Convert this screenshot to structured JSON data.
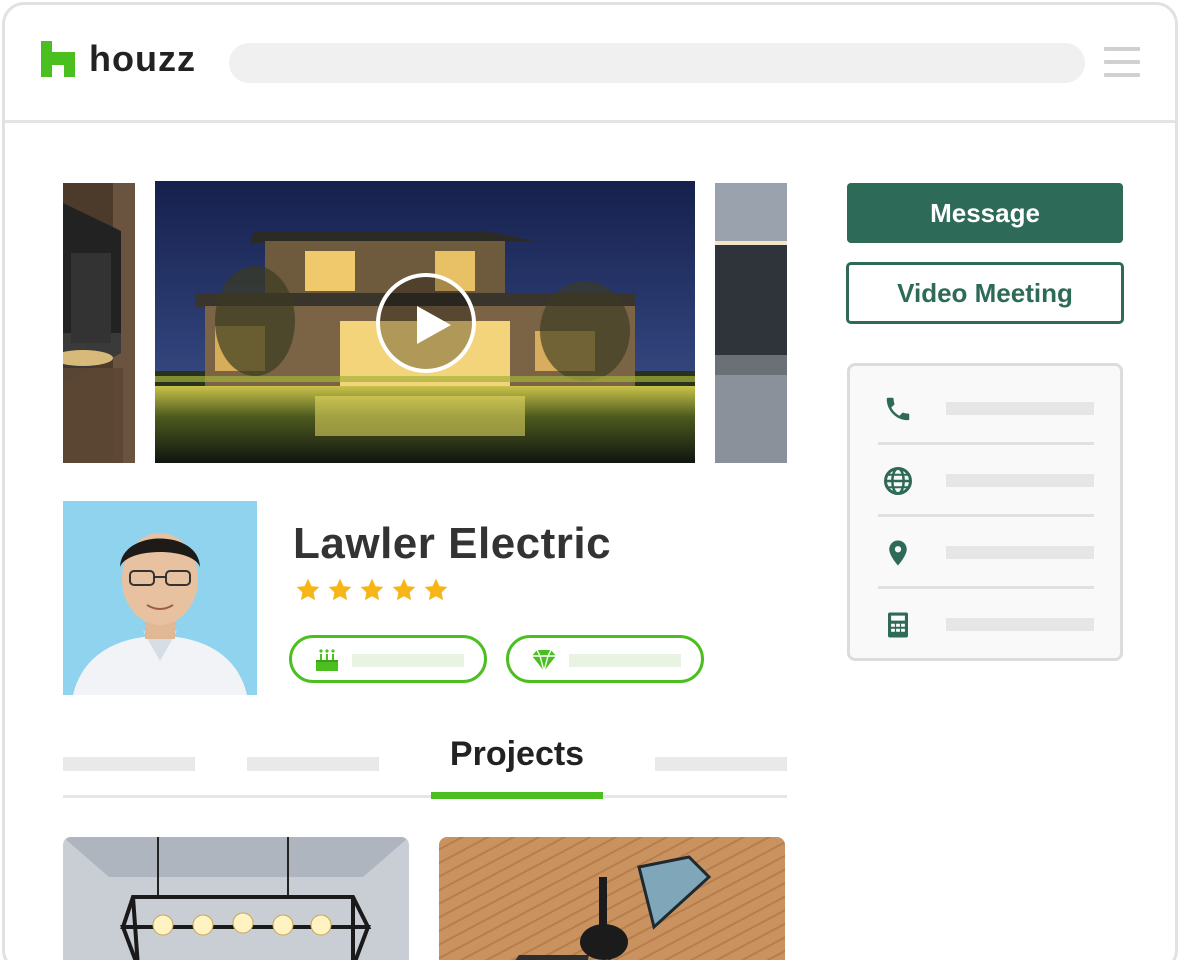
{
  "header": {
    "brand": "houzz",
    "logo_icon": "houzz-logo-icon",
    "search": {
      "value": "",
      "placeholder": ""
    },
    "menu_icon": "hamburger-menu-icon"
  },
  "gallery": {
    "play_icon": "play-icon"
  },
  "profile": {
    "name": "Lawler Electric",
    "rating": 5,
    "rating_max": 5,
    "badges": [
      {
        "icon": "anniversary-cake-icon"
      },
      {
        "icon": "diamond-icon"
      }
    ]
  },
  "tabs": {
    "active_label": "Projects"
  },
  "actions": {
    "message_label": "Message",
    "video_label": "Video Meeting"
  },
  "contact": {
    "items": [
      {
        "icon": "phone-icon"
      },
      {
        "icon": "globe-icon"
      },
      {
        "icon": "location-pin-icon"
      },
      {
        "icon": "calculator-icon"
      }
    ]
  },
  "colors": {
    "brand_green": "#4bbf1f",
    "action_green": "#2d6a57",
    "star": "#f7b618",
    "placeholder_gray": "#e6e6e6"
  }
}
